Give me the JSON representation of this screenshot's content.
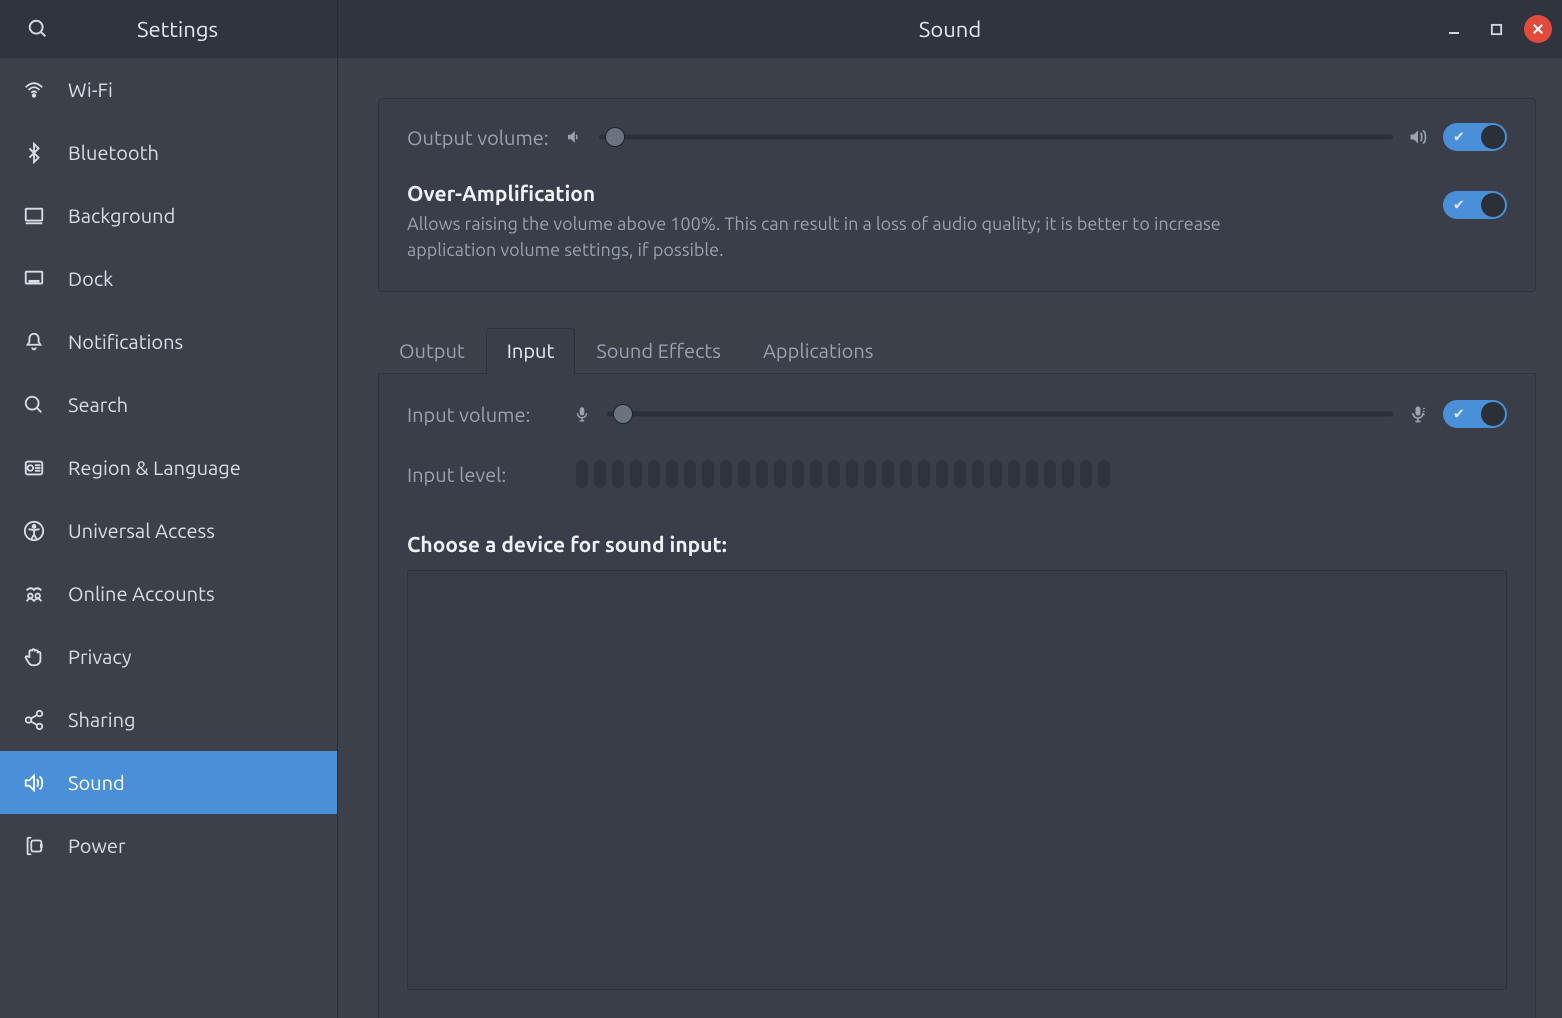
{
  "app_title": "Settings",
  "page_title": "Sound",
  "sidebar": {
    "items": [
      {
        "id": "wifi",
        "label": "Wi-Fi",
        "icon": "wifi-icon"
      },
      {
        "id": "bluetooth",
        "label": "Bluetooth",
        "icon": "bluetooth-icon"
      },
      {
        "id": "background",
        "label": "Background",
        "icon": "display-icon"
      },
      {
        "id": "dock",
        "label": "Dock",
        "icon": "dock-icon"
      },
      {
        "id": "notifications",
        "label": "Notifications",
        "icon": "bell-icon"
      },
      {
        "id": "search",
        "label": "Search",
        "icon": "search-icon"
      },
      {
        "id": "region",
        "label": "Region & Language",
        "icon": "globe-icon"
      },
      {
        "id": "universal",
        "label": "Universal Access",
        "icon": "accessibility-icon"
      },
      {
        "id": "online",
        "label": "Online Accounts",
        "icon": "accounts-icon"
      },
      {
        "id": "privacy",
        "label": "Privacy",
        "icon": "hand-icon"
      },
      {
        "id": "sharing",
        "label": "Sharing",
        "icon": "share-icon"
      },
      {
        "id": "sound",
        "label": "Sound",
        "icon": "speaker-icon"
      },
      {
        "id": "power",
        "label": "Power",
        "icon": "power-icon"
      }
    ],
    "active_id": "sound"
  },
  "output": {
    "volume_label": "Output volume:",
    "volume_percent": 2,
    "toggle_on": true,
    "amp_title": "Over-Amplification",
    "amp_desc": "Allows raising the volume above 100%. This can result in a loss of audio quality; it is better to increase application volume settings, if possible.",
    "amp_on": true
  },
  "tabs": [
    {
      "id": "output",
      "label": "Output"
    },
    {
      "id": "input",
      "label": "Input"
    },
    {
      "id": "soundeffects",
      "label": "Sound Effects"
    },
    {
      "id": "applications",
      "label": "Applications"
    }
  ],
  "active_tab": "input",
  "input": {
    "volume_label": "Input volume:",
    "volume_percent": 2,
    "toggle_on": true,
    "level_label": "Input level:",
    "level_bars": 30,
    "choose_label": "Choose a device for sound input:"
  }
}
